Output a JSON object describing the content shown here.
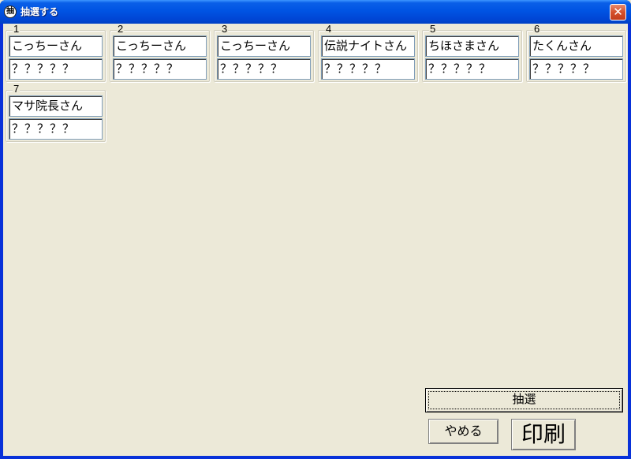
{
  "window": {
    "title": "抽選する",
    "app_icon_glyph": "抽",
    "close_glyph": "✕"
  },
  "participants": [
    {
      "number": "1",
      "name": "こっちーさん",
      "result": "？？？？？"
    },
    {
      "number": "2",
      "name": "こっちーさん",
      "result": "？？？？？"
    },
    {
      "number": "3",
      "name": "こっちーさん",
      "result": "？？？？？"
    },
    {
      "number": "4",
      "name": "伝説ナイトさん",
      "result": "？？？？？"
    },
    {
      "number": "5",
      "name": "ちほさまさん",
      "result": "？？？？？"
    },
    {
      "number": "6",
      "name": "たくんさん",
      "result": "？？？？？"
    },
    {
      "number": "7",
      "name": "マサ院長さん",
      "result": "？？？？？"
    }
  ],
  "buttons": {
    "draw_label": "抽選",
    "cancel_label": "やめる",
    "print_label": "印刷"
  }
}
